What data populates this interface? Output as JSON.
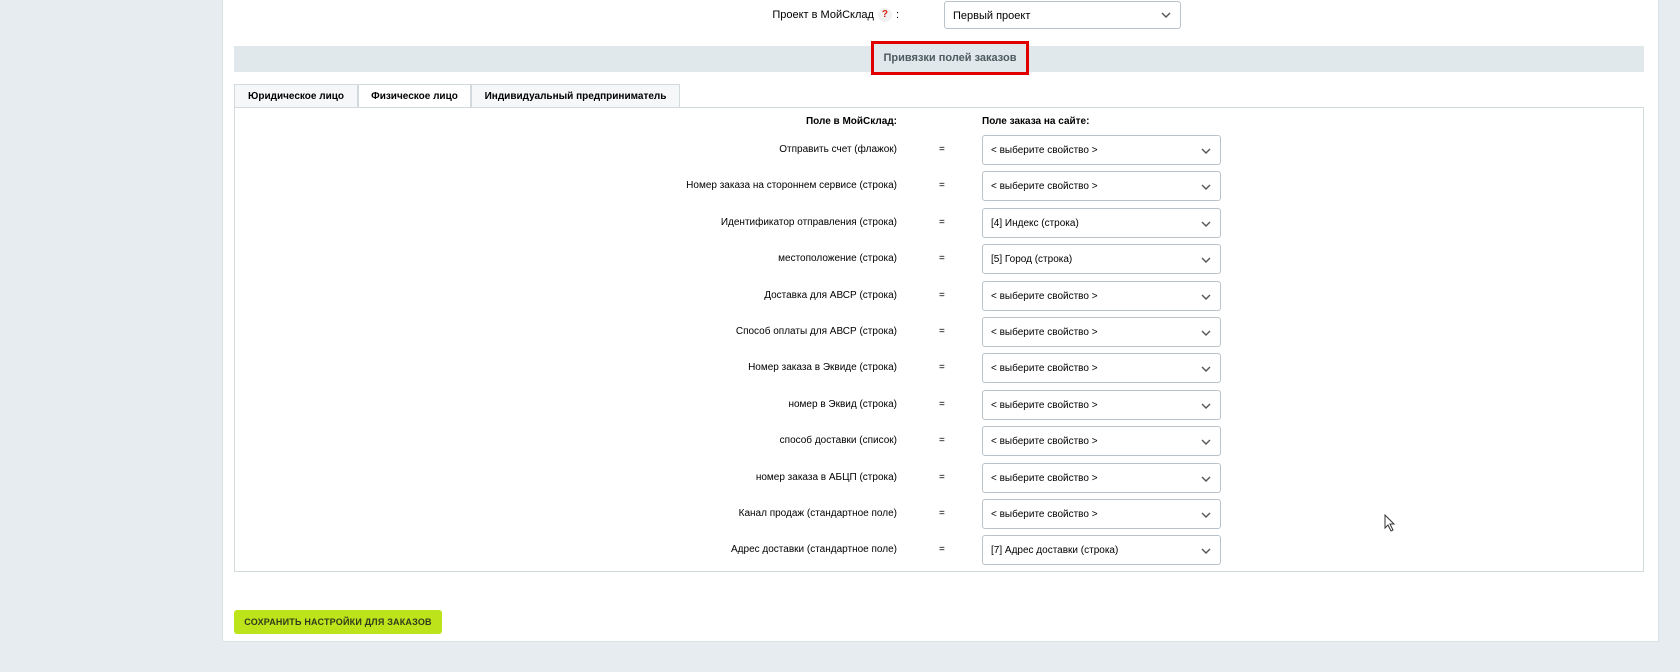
{
  "project": {
    "label": "Проект в МойСклад",
    "help": "?",
    "colon": ":",
    "selected": "Первый проект"
  },
  "section": {
    "title": "Привязки полей заказов"
  },
  "tabs": [
    {
      "label": "Юридическое лицо",
      "active": false
    },
    {
      "label": "Физическое лицо",
      "active": true
    },
    {
      "label": "Индивидуальный предприниматель",
      "active": false
    }
  ],
  "columns": {
    "left": "Поле в МойСклад:",
    "right": "Поле заказа на сайте:"
  },
  "eq": "=",
  "rows": [
    {
      "label": "Отправить счет (флажок)",
      "value": "< выберите свойство >"
    },
    {
      "label": "Номер заказа на стороннем сервисе (строка)",
      "value": "< выберите свойство >"
    },
    {
      "label": "Идентификатор отправления (строка)",
      "value": "[4] Индекс (строка)"
    },
    {
      "label": "местоположение (строка)",
      "value": "[5] Город (строка)"
    },
    {
      "label": "Доставка для АВСР (строка)",
      "value": "< выберите свойство >"
    },
    {
      "label": "Способ оплаты для АВСР (строка)",
      "value": "< выберите свойство >"
    },
    {
      "label": "Номер заказа в Эквиде (строка)",
      "value": "< выберите свойство >"
    },
    {
      "label": "номер в Эквид (строка)",
      "value": "< выберите свойство >"
    },
    {
      "label": "способ доставки (список)",
      "value": "< выберите свойство >"
    },
    {
      "label": "номер заказа в АБЦП (строка)",
      "value": "< выберите свойство >"
    },
    {
      "label": "Канал продаж (стандартное поле)",
      "value": "< выберите свойство >"
    },
    {
      "label": "Адрес доставки (стандартное поле)",
      "value": "[7] Адрес доставки (строка)"
    }
  ],
  "save_button": "СОХРАНИТЬ НАСТРОЙКИ ДЛЯ ЗАКАЗОВ"
}
